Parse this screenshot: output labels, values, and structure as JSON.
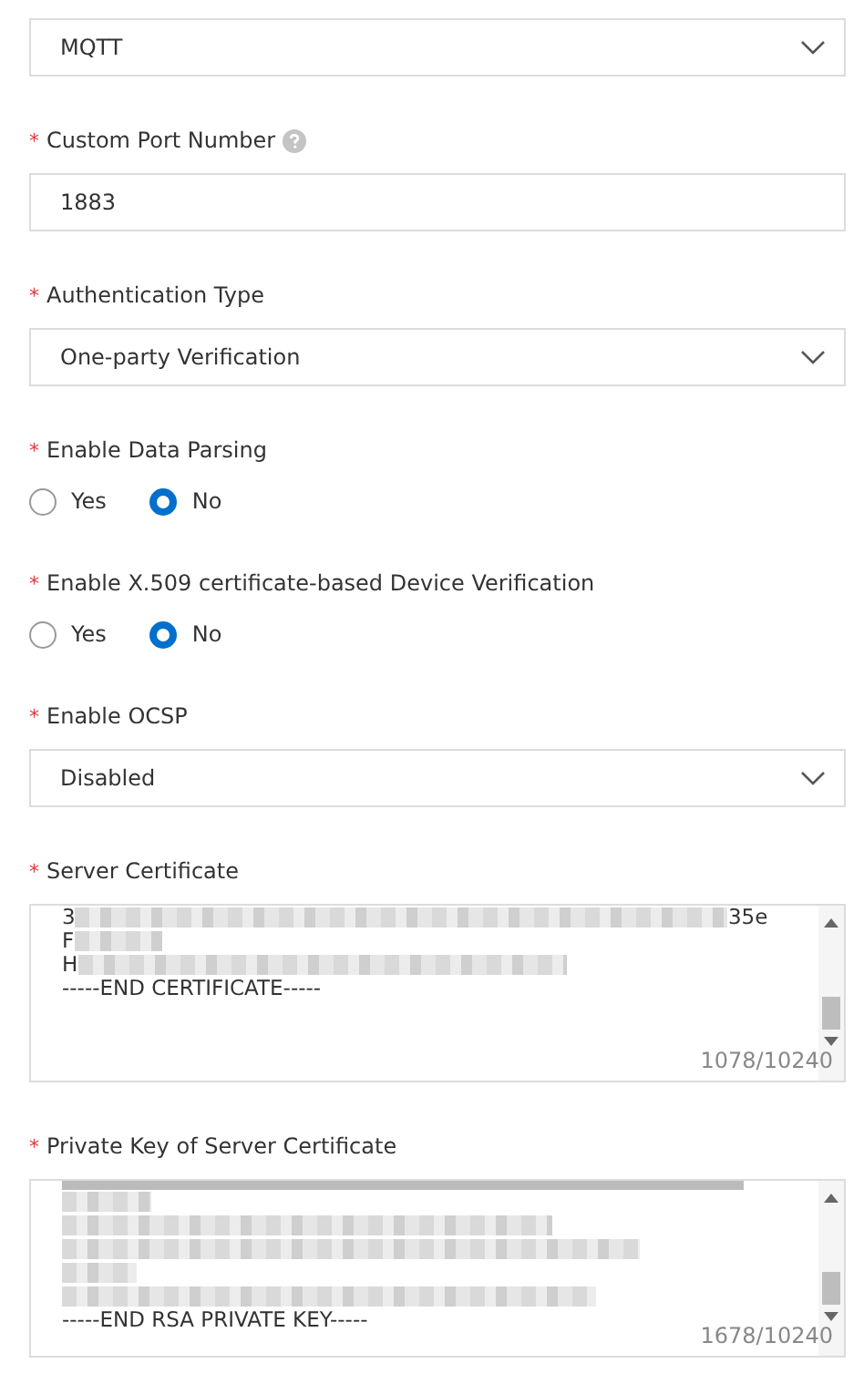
{
  "fields": [
    {
      "kind": "select",
      "value": "MQTT"
    },
    {
      "kind": "input",
      "label": "Custom Port Number",
      "marker": "*",
      "help": true,
      "value": "1883"
    },
    {
      "kind": "select",
      "label": "Authentication Type",
      "marker": "*",
      "value": "One-party Verification"
    },
    {
      "kind": "radio",
      "label": "Enable Data Parsing",
      "marker": "*",
      "options": [
        {
          "label": "Yes",
          "selected": false
        },
        {
          "label": "No",
          "selected": true
        }
      ]
    },
    {
      "kind": "radio",
      "label": "Enable X.509 certificate-based Device Verification",
      "marker": "*",
      "options": [
        {
          "label": "Yes",
          "selected": false
        },
        {
          "label": "No",
          "selected": true
        }
      ]
    },
    {
      "kind": "select",
      "label": "Enable OCSP",
      "marker": "*",
      "value": "Disabled"
    },
    {
      "kind": "textarea",
      "label": "Server Certificate",
      "marker": "*",
      "count": "1078/10240",
      "lines": [
        {
          "kind": "redacted",
          "text": "3",
          "tail": "35e"
        },
        {
          "kind": "redacted",
          "text": "F"
        },
        {
          "kind": "redacted",
          "text": "H"
        },
        {
          "kind": "text",
          "text": "-----END CERTIFICATE-----"
        }
      ]
    },
    {
      "kind": "textarea",
      "label": "Private Key of Server Certificate",
      "marker": "*",
      "count": "1678/10240",
      "lines": [
        {
          "kind": "cut"
        },
        {
          "kind": "redacted"
        },
        {
          "kind": "redacted"
        },
        {
          "kind": "redacted"
        },
        {
          "kind": "redacted"
        },
        {
          "kind": "redacted"
        },
        {
          "kind": "text",
          "text": "-----END RSA PRIVATE KEY-----"
        }
      ]
    }
  ]
}
